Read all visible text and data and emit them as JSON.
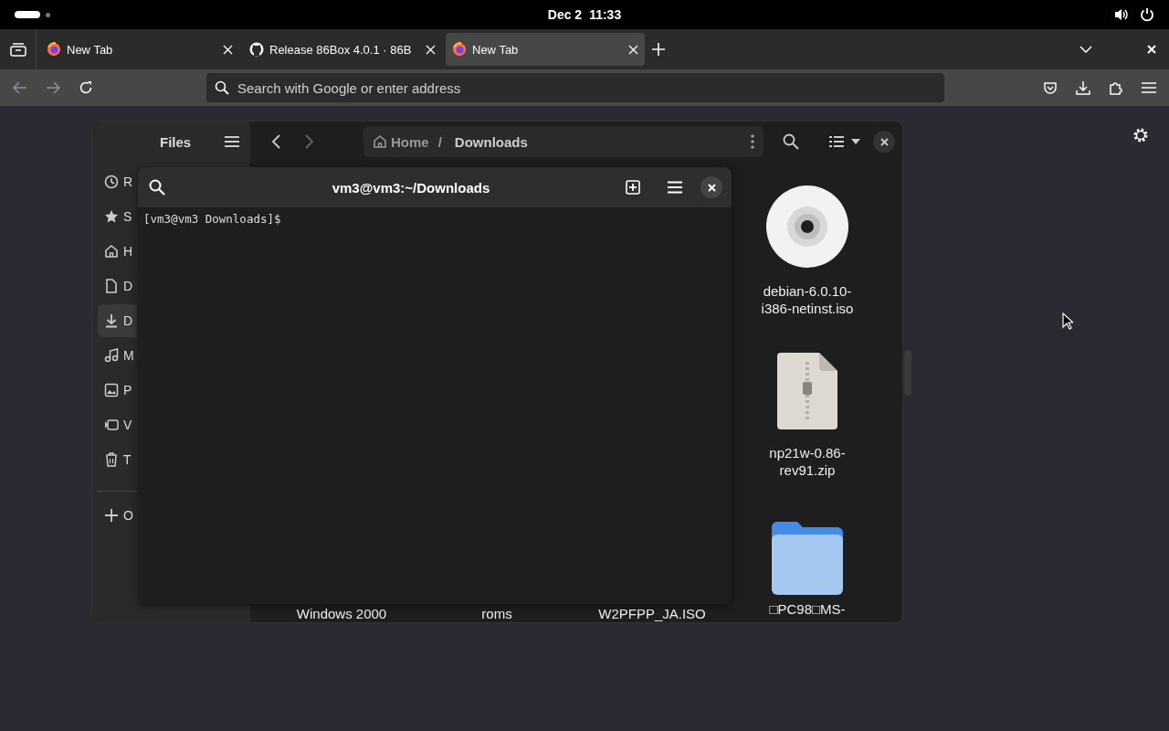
{
  "top_bar": {
    "date": "Dec 2",
    "time": "11:33"
  },
  "browser": {
    "tabs": [
      {
        "title": "New Tab",
        "selected": false
      },
      {
        "title": "Release 86Box 4.0.1 · 86B",
        "selected": false
      },
      {
        "title": "New Tab",
        "selected": true
      }
    ],
    "address_bar": {
      "placeholder": "Search with Google or enter address"
    }
  },
  "files_window": {
    "title": "Files",
    "breadcrumbs": [
      {
        "label": "Home",
        "kind": "home"
      },
      {
        "label": "/",
        "kind": "separator"
      },
      {
        "label": "Downloads",
        "kind": "current"
      }
    ],
    "sidebar_items": [
      {
        "label": "R",
        "selected": false
      },
      {
        "label": "S",
        "selected": false
      },
      {
        "label": "H",
        "selected": false
      },
      {
        "label": "D",
        "selected": false
      },
      {
        "label": "D",
        "selected": true
      },
      {
        "label": "M",
        "selected": false
      },
      {
        "label": "P",
        "selected": false
      },
      {
        "label": "V",
        "selected": false
      },
      {
        "label": "T",
        "selected": false
      }
    ],
    "other_locations": {
      "label": "O"
    },
    "files_column": [
      {
        "name": "debian-6.0.10-i386-netinst.iso",
        "kind": "disc"
      },
      {
        "name": "np21w-0.86-rev91.zip",
        "kind": "archive"
      }
    ],
    "files_row": [
      {
        "name": "Windows 2000",
        "kind": "label_only"
      },
      {
        "name": "roms",
        "kind": "label_only"
      },
      {
        "name": "W2PFPP_JA.ISO",
        "kind": "label_only"
      },
      {
        "name": "□PC98□MS-",
        "kind": "folder"
      }
    ]
  },
  "terminal": {
    "title": "vm3@vm3:~/Downloads",
    "prompt": "[vm3@vm3 Downloads]$"
  }
}
